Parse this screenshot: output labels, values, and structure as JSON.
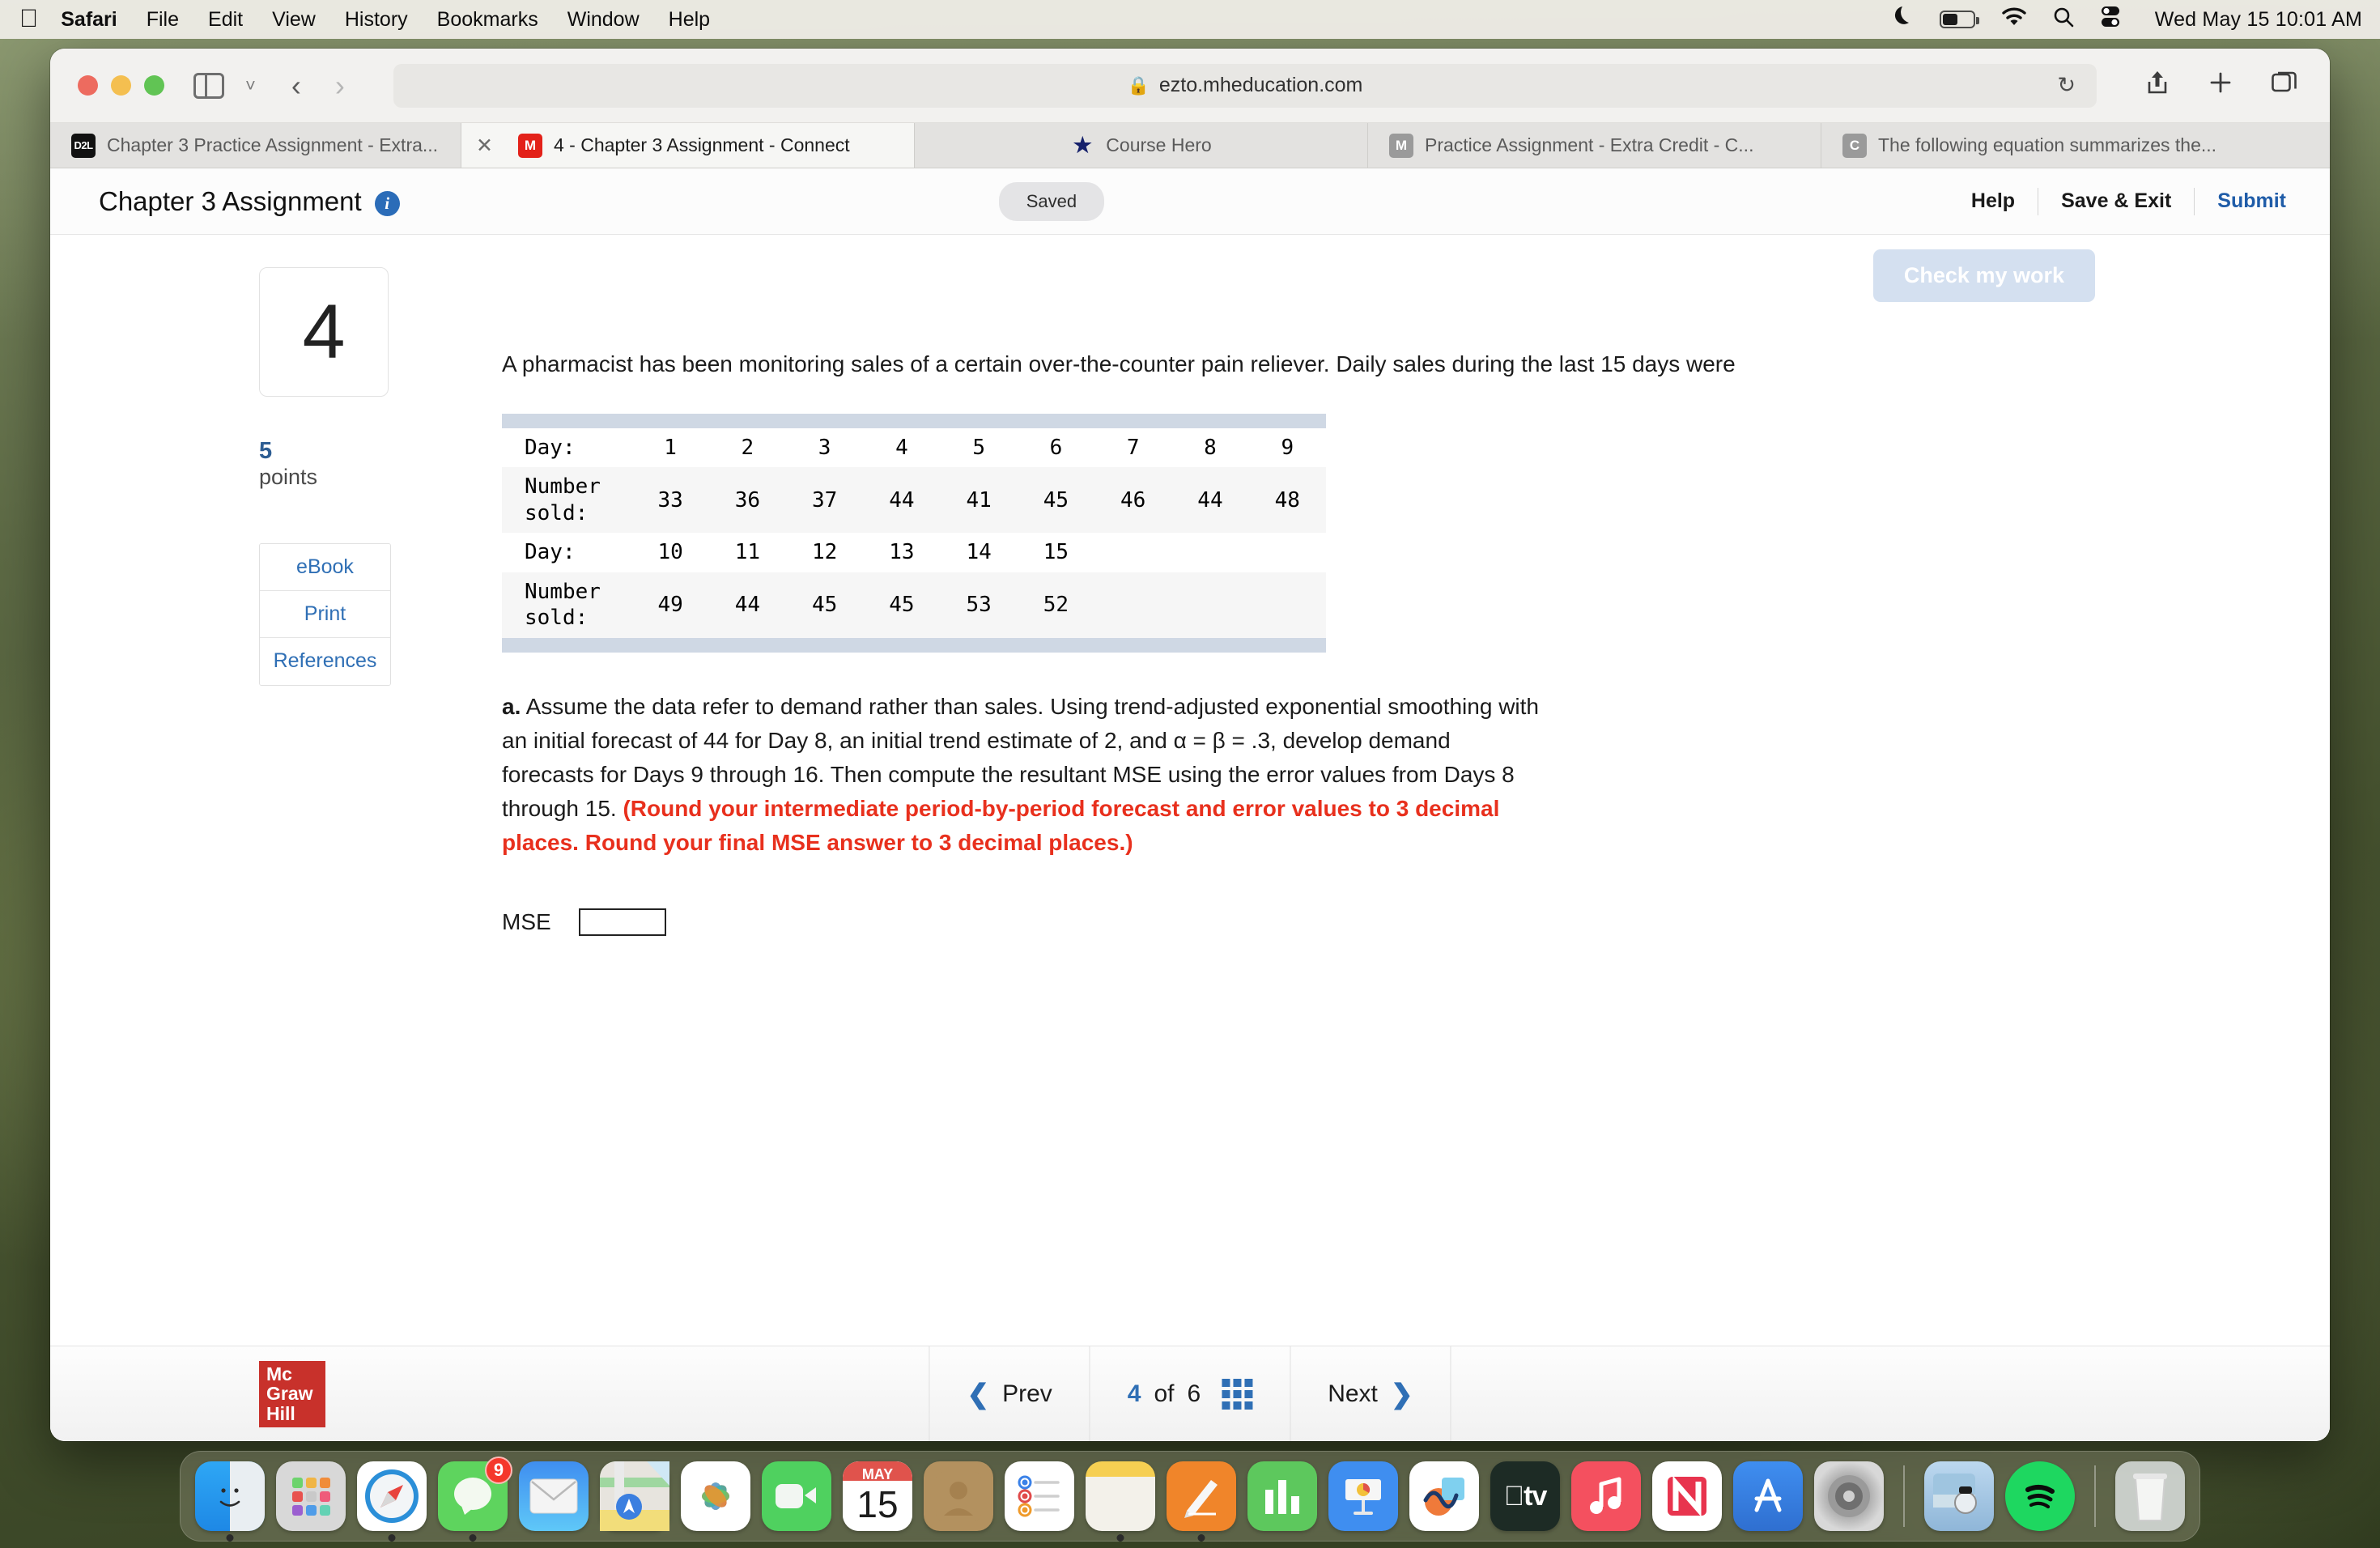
{
  "menubar": {
    "apple": "apple-logo",
    "items": [
      "Safari",
      "File",
      "Edit",
      "View",
      "History",
      "Bookmarks",
      "Window",
      "Help"
    ],
    "status_icons": [
      "moon-icon",
      "battery-icon",
      "wifi-icon",
      "search-icon",
      "control-center-icon"
    ],
    "clock": "Wed May 15  10:01 AM"
  },
  "browser": {
    "url": "ezto.mheducation.com",
    "lock": "lock-icon",
    "reload": "reload-icon",
    "tabs": [
      {
        "favicon": "d2l-icon",
        "favicon_text": "D2L",
        "label": "Chapter 3 Practice Assignment - Extra...",
        "active": false
      },
      {
        "favicon": "mheducation-icon",
        "favicon_text": "M",
        "label": "4 - Chapter 3 Assignment - Connect",
        "active": true
      },
      {
        "favicon": "coursehero-icon",
        "favicon_text": "★",
        "label": "Course Hero",
        "active": false
      },
      {
        "favicon": "mheducation-gray-icon",
        "favicon_text": "M",
        "label": "Practice Assignment - Extra Credit - C...",
        "active": false
      },
      {
        "favicon": "chegg-icon",
        "favicon_text": "C",
        "label": "The following equation summarizes the...",
        "active": false
      }
    ]
  },
  "app_header": {
    "title": "Chapter 3 Assignment",
    "info_icon": "info-icon",
    "saved_label": "Saved",
    "help_label": "Help",
    "save_exit_label": "Save & Exit",
    "submit_label": "Submit"
  },
  "question": {
    "number": "4",
    "points_value": "5",
    "points_label": "points",
    "side_buttons": [
      "eBook",
      "Print",
      "References"
    ],
    "check_my_work": "Check my work",
    "prompt": "A pharmacist has been monitoring sales of a certain over-the-counter pain reliever. Daily sales during the last 15 days were",
    "part_a_label": "a.",
    "part_a_text": " Assume the data refer to demand rather than sales. Using trend-adjusted exponential smoothing with an initial forecast of 44 for Day 8, an initial trend estimate of 2, and α = β = .3, develop demand forecasts for Days 9 through 16. Then compute the resultant MSE using the error values from Days 8 through 15. ",
    "part_a_red": "(Round your intermediate period-by-period forecast and error values to 3 decimal places.  Round your final MSE answer to 3 decimal places.)",
    "answer_label": "MSE",
    "answer_value": ""
  },
  "data_table": {
    "row_labels": [
      "Day:",
      "Number sold:",
      "Day:",
      "Number sold:"
    ],
    "rows": [
      {
        "label": "Day:",
        "cells": [
          "1",
          "2",
          "3",
          "4",
          "5",
          "6",
          "7",
          "8",
          "9"
        ]
      },
      {
        "label": "Number sold:",
        "cells": [
          "33",
          "36",
          "37",
          "44",
          "41",
          "45",
          "46",
          "44",
          "48"
        ]
      },
      {
        "label": "Day:",
        "cells": [
          "10",
          "11",
          "12",
          "13",
          "14",
          "15",
          "",
          "",
          ""
        ]
      },
      {
        "label": "Number sold:",
        "cells": [
          "49",
          "44",
          "45",
          "45",
          "53",
          "52",
          "",
          "",
          ""
        ]
      }
    ]
  },
  "footer": {
    "logo_line1": "Mc",
    "logo_line2": "Graw",
    "logo_line3": "Hill",
    "prev_label": "Prev",
    "current_page": "4",
    "of_label": "of",
    "total_pages": "6",
    "grid_icon": "grid-icon",
    "next_label": "Next"
  },
  "dock": {
    "items": [
      {
        "name": "finder",
        "badge": "",
        "running": true
      },
      {
        "name": "launchpad",
        "badge": "",
        "running": false
      },
      {
        "name": "safari",
        "badge": "",
        "running": true
      },
      {
        "name": "messages",
        "badge": "9",
        "running": true
      },
      {
        "name": "mail",
        "badge": "",
        "running": false
      },
      {
        "name": "maps",
        "badge": "",
        "running": false
      },
      {
        "name": "photos",
        "badge": "",
        "running": false
      },
      {
        "name": "facetime",
        "badge": "",
        "running": false
      },
      {
        "name": "calendar",
        "badge": "",
        "running": false,
        "month": "MAY",
        "day": "15"
      },
      {
        "name": "contacts",
        "badge": "",
        "running": false
      },
      {
        "name": "reminders",
        "badge": "",
        "running": false
      },
      {
        "name": "notes",
        "badge": "",
        "running": true
      },
      {
        "name": "pages",
        "badge": "",
        "running": true
      },
      {
        "name": "numbers",
        "badge": "",
        "running": false
      },
      {
        "name": "keynote",
        "badge": "",
        "running": false
      },
      {
        "name": "freeform",
        "badge": "",
        "running": false
      },
      {
        "name": "appletv",
        "badge": "",
        "running": false
      },
      {
        "name": "music",
        "badge": "",
        "running": false
      },
      {
        "name": "news",
        "badge": "",
        "running": false
      },
      {
        "name": "appstore",
        "badge": "",
        "running": false
      },
      {
        "name": "system-settings",
        "badge": "",
        "running": false
      },
      {
        "name": "preview",
        "badge": "",
        "running": false
      },
      {
        "name": "spotify",
        "badge": "",
        "running": false
      },
      {
        "name": "trash",
        "badge": "",
        "running": false
      }
    ]
  }
}
